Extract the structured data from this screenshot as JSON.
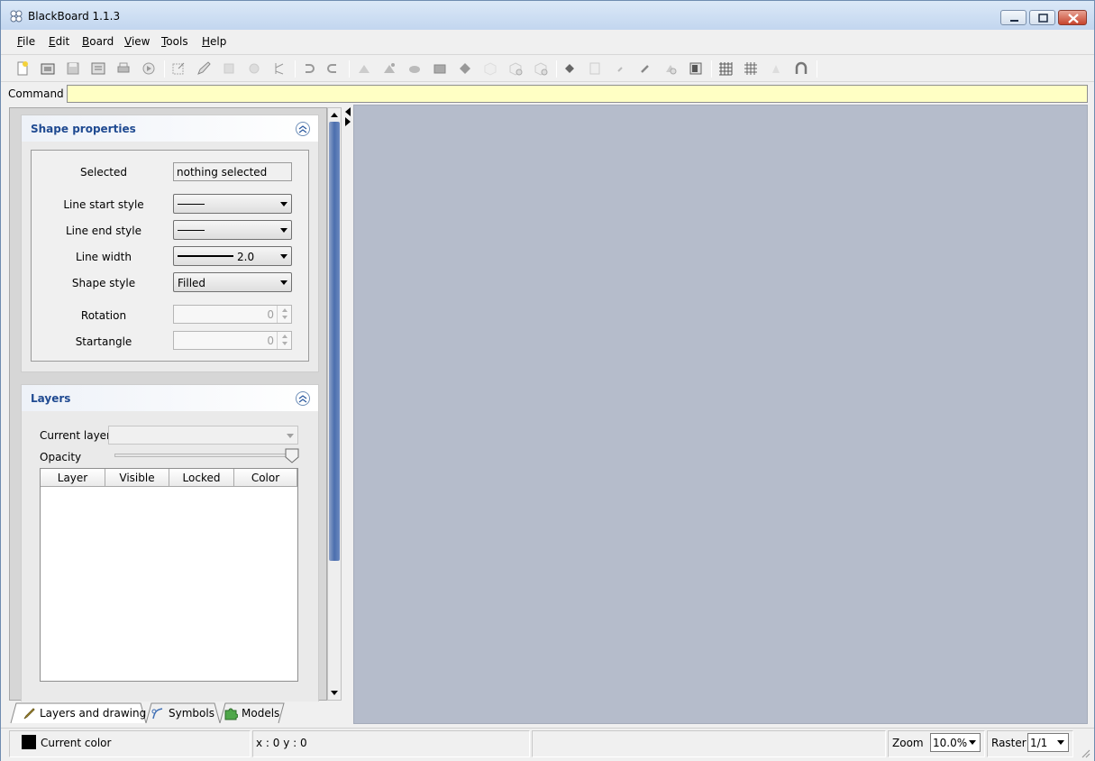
{
  "window": {
    "title": "BlackBoard 1.1.3",
    "controls": [
      "minimize-icon",
      "restore-icon",
      "close-icon"
    ]
  },
  "menu": [
    {
      "label": "File",
      "first": "F",
      "rest": "ile"
    },
    {
      "label": "Edit",
      "first": "E",
      "rest": "dit"
    },
    {
      "label": "Board",
      "first": "B",
      "rest": "oard"
    },
    {
      "label": "View",
      "first": "V",
      "rest": "iew"
    },
    {
      "label": "Tools",
      "first": "T",
      "rest": "ools"
    },
    {
      "label": "Help",
      "first": "H",
      "rest": "elp"
    }
  ],
  "toolbar": {
    "icons": [
      "new-icon",
      "open-icon",
      "save-icon",
      "export-icon",
      "print-icon",
      "play-icon",
      "select-icon",
      "pencil-icon",
      "rectangle-icon",
      "circle-icon",
      "pointer-icon",
      "undo-icon",
      "redo-icon",
      "shape-a-icon",
      "shape-b-icon",
      "shape-c-icon",
      "layer-icon",
      "shape-d-icon",
      "cube-icon",
      "cube-add-icon",
      "cube-remove-icon",
      "fill-icon",
      "paste-icon",
      "pen-small-icon",
      "pen-icon",
      "shape-e-icon",
      "window-icon",
      "grid-icon",
      "grid-fine-icon",
      "pen-tip-icon",
      "magnet-icon"
    ]
  },
  "command": {
    "label": "Command :",
    "value": ""
  },
  "shape_properties": {
    "title": "Shape properties",
    "selected_label": "Selected",
    "selected_value": "nothing selected",
    "line_start_label": "Line start style",
    "line_end_label": "Line end style",
    "line_width_label": "Line width",
    "line_width_value": "2.0",
    "shape_style_label": "Shape style",
    "shape_style_value": "Filled",
    "rotation_label": "Rotation",
    "rotation_value": "0",
    "startangle_label": "Startangle",
    "startangle_value": "0"
  },
  "layers": {
    "title": "Layers",
    "current_layer_label": "Current layer",
    "current_layer_value": "",
    "opacity_label": "Opacity",
    "opacity_value": 1.0,
    "columns": [
      "Layer",
      "Visible",
      "Locked",
      "Color"
    ]
  },
  "bottom_tabs": [
    {
      "label": "Layers and drawing",
      "icon": "brush-icon"
    },
    {
      "label": "Symbols",
      "icon": "symbol-icon"
    },
    {
      "label": "Models",
      "icon": "puzzle-icon"
    }
  ],
  "status": {
    "current_color_label": "Current color",
    "current_color": "#000000",
    "coords": "x : 0 y : 0",
    "zoom_label": "Zoom",
    "zoom_value": "10.0%",
    "raster_label": "Raster",
    "raster_value": "1/1"
  },
  "colors": {
    "canvas": "#b5bccb",
    "command_bg": "#ffffc4",
    "scroll_thumb": "#4b6eae",
    "section_title": "#1f4a91"
  }
}
